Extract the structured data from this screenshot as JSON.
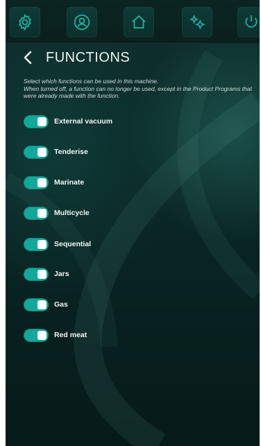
{
  "topbar": {
    "icons": [
      "gear-icon",
      "user-icon",
      "home-icon",
      "sparkle-icon",
      "power-icon"
    ]
  },
  "header": {
    "back_icon": "chevron-left-icon",
    "title": "FUNCTIONS"
  },
  "description": {
    "line1": "Select which functions can be used in this machine.",
    "line2": "When turned off, a function can no longer be used, except in the Product Programs that were already made with the function."
  },
  "functions": [
    {
      "label": "External vacuum",
      "enabled": true
    },
    {
      "label": "Tenderise",
      "enabled": true
    },
    {
      "label": "Marinate",
      "enabled": true
    },
    {
      "label": "Multicycle",
      "enabled": true
    },
    {
      "label": "Sequential",
      "enabled": true
    },
    {
      "label": "Jars",
      "enabled": true
    },
    {
      "label": "Gas",
      "enabled": true
    },
    {
      "label": "Red meat",
      "enabled": true
    }
  ],
  "colors": {
    "accent": "#12a89b",
    "background": "#0a2826"
  }
}
